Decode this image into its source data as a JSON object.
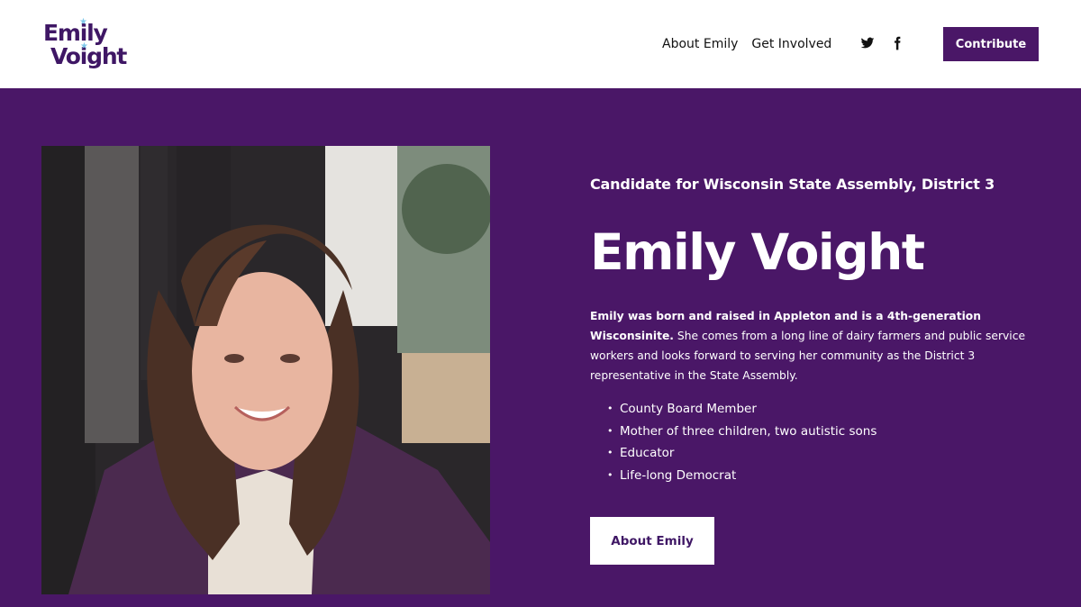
{
  "brand": {
    "logo_line1": "Emily",
    "logo_line2": "Voight",
    "primary_color": "#4a1767",
    "star_color": "#7fc8ea"
  },
  "nav": {
    "items": [
      {
        "label": "About Emily"
      },
      {
        "label": "Get Involved"
      }
    ],
    "social": [
      {
        "icon": "twitter-icon"
      },
      {
        "icon": "facebook-icon"
      }
    ],
    "contribute_label": "Contribute"
  },
  "hero": {
    "subtitle": "Candidate for Wisconsin State Assembly, District 3",
    "name": "Emily Voight",
    "bio_bold": "Emily was born and raised in Appleton and is a 4th-generation Wisconsinite.",
    "bio_rest": "She comes from a long line of dairy farmers and public service workers and looks forward to serving her community as the District 3 representative in the State Assembly.",
    "points": [
      "County Board Member",
      "Mother of three children, two autistic sons",
      "Educator",
      "Life-long Democrat"
    ],
    "button_label": "About Emily"
  }
}
